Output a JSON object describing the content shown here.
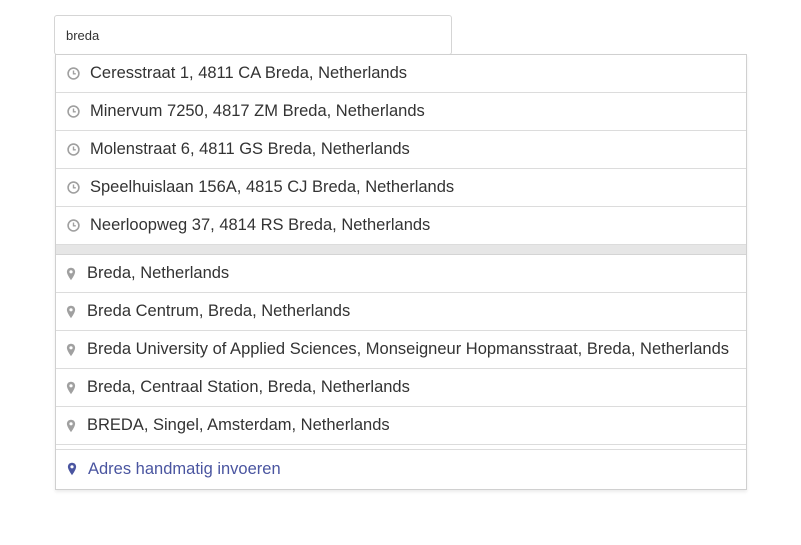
{
  "search": {
    "value": "breda"
  },
  "recent_results": [
    {
      "label": "Ceresstraat 1, 4811 CA Breda, Netherlands",
      "icon": "clock-icon"
    },
    {
      "label": "Minervum 7250, 4817 ZM Breda, Netherlands",
      "icon": "clock-icon"
    },
    {
      "label": "Molenstraat 6, 4811 GS Breda, Netherlands",
      "icon": "clock-icon"
    },
    {
      "label": "Speelhuislaan 156A, 4815 CJ Breda, Netherlands",
      "icon": "clock-icon"
    },
    {
      "label": "Neerloopweg 37, 4814 RS Breda, Netherlands",
      "icon": "clock-icon"
    }
  ],
  "place_results": [
    {
      "label": "Breda, Netherlands",
      "icon": "map-pin-icon"
    },
    {
      "label": "Breda Centrum, Breda, Netherlands",
      "icon": "map-pin-icon"
    },
    {
      "label": "Breda University of Applied Sciences, Monseigneur Hopmansstraat, Breda, Netherlands",
      "icon": "map-pin-icon"
    },
    {
      "label": "Breda, Centraal Station, Breda, Netherlands",
      "icon": "map-pin-icon"
    },
    {
      "label": "BREDA, Singel, Amsterdam, Netherlands",
      "icon": "map-pin-icon"
    }
  ],
  "manual_entry": {
    "label": "Adres handmatig invoeren",
    "icon": "map-marker-icon"
  },
  "colors": {
    "text": "#333333",
    "icon_gray": "#a0a0a0",
    "link_blue": "#4a55a0",
    "separator": "#e6e6e6",
    "border": "#d0d0d0"
  }
}
